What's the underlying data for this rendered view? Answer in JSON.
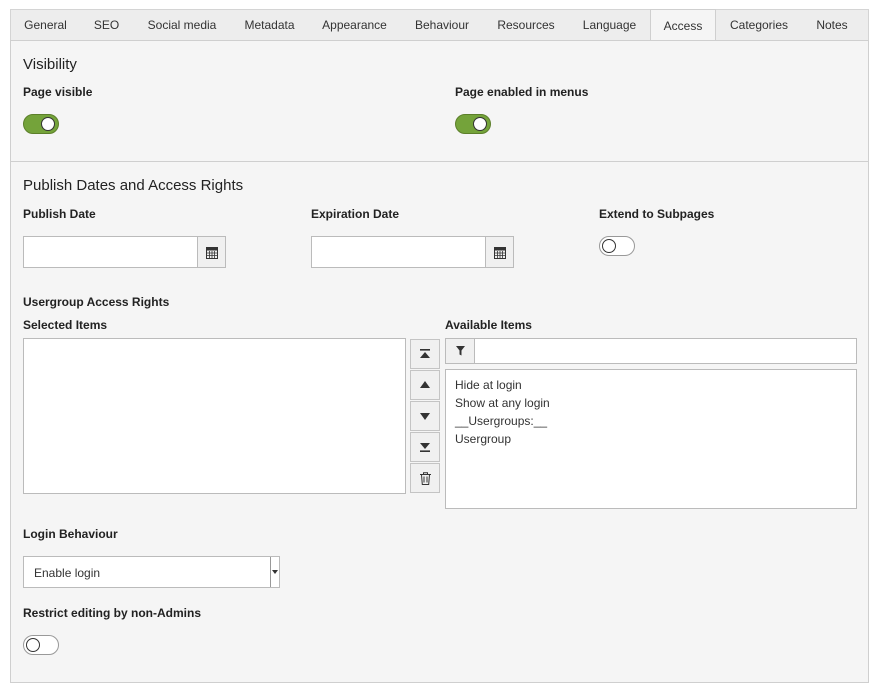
{
  "tabs": [
    "General",
    "SEO",
    "Social media",
    "Metadata",
    "Appearance",
    "Behaviour",
    "Resources",
    "Language",
    "Access",
    "Categories",
    "Notes"
  ],
  "active_tab": "Access",
  "visibility": {
    "heading": "Visibility",
    "page_visible_label": "Page visible",
    "page_visible": true,
    "menus_label": "Page enabled in menus",
    "menus_enabled": true
  },
  "publish": {
    "heading": "Publish Dates and Access Rights",
    "publish_date_label": "Publish Date",
    "publish_date_value": "",
    "expiration_date_label": "Expiration Date",
    "expiration_date_value": "",
    "extend_label": "Extend to Subpages",
    "extend": false
  },
  "usergroup": {
    "heading": "Usergroup Access Rights",
    "selected_label": "Selected Items",
    "available_label": "Available Items",
    "filter_value": "",
    "available_items": [
      "Hide at login",
      "Show at any login",
      "__Usergroups:__",
      "Usergroup"
    ]
  },
  "login": {
    "label": "Login Behaviour",
    "selected": "Enable login"
  },
  "restrict": {
    "label": "Restrict editing by non-Admins",
    "enabled": false
  },
  "icons": {
    "calendar": "calendar-icon",
    "move_top": "move-to-top-icon",
    "move_up": "move-up-icon",
    "move_down": "move-down-icon",
    "move_bottom": "move-to-bottom-icon",
    "delete": "trash-icon",
    "filter": "filter-icon"
  },
  "colors": {
    "toggle_on": "#74a33a",
    "panel_bg": "#f5f5f5",
    "tabbar_bg": "#ededed"
  }
}
